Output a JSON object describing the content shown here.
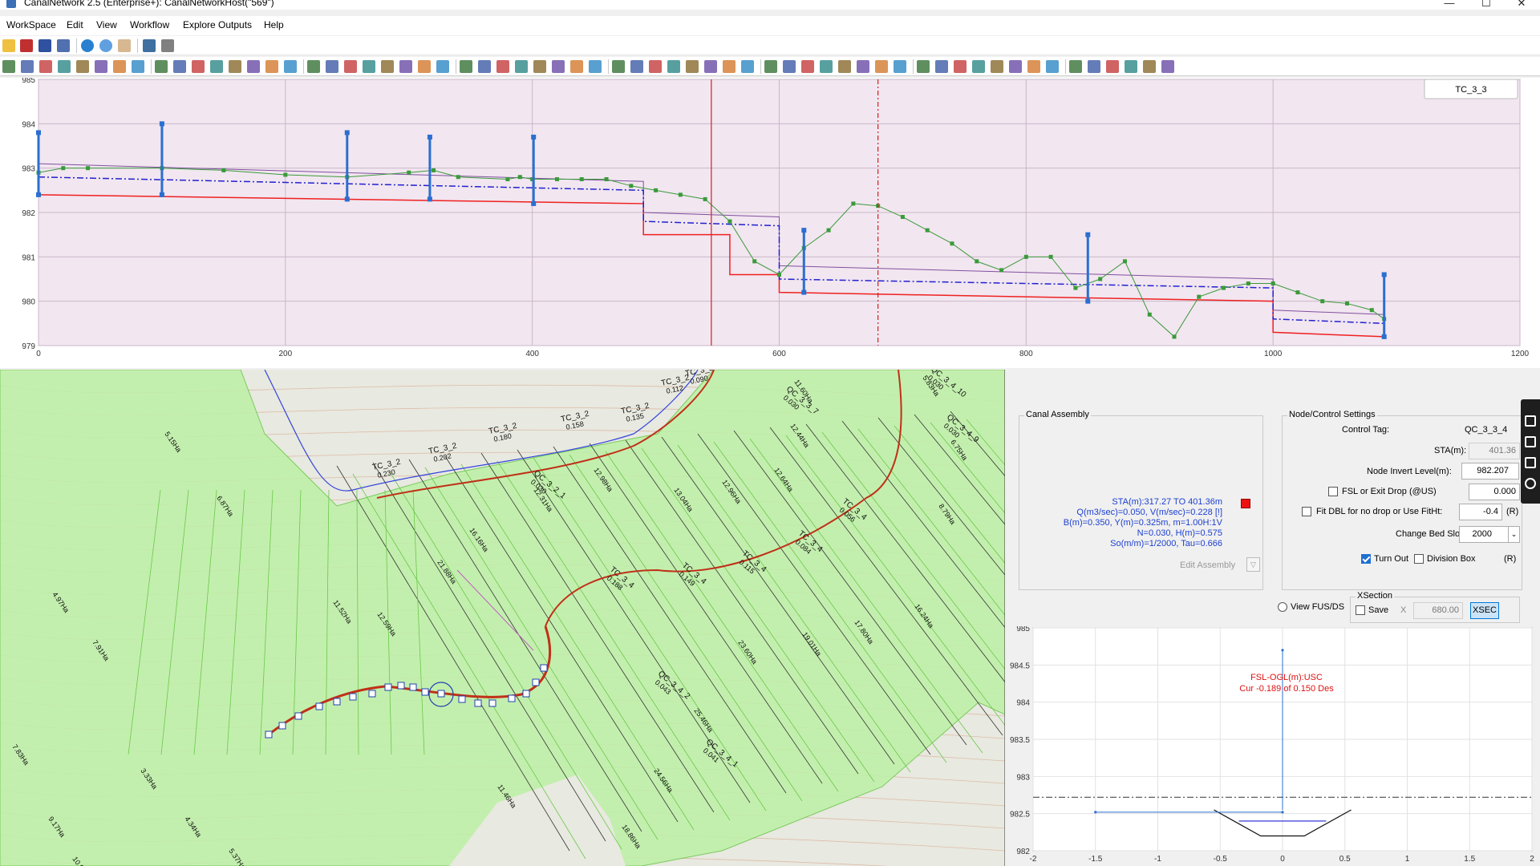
{
  "window": {
    "title": "CanalNetwork 2.5  (Enterprise+): CanalNetworkHost(\"569\")",
    "controls": [
      "—",
      "☐",
      "✕"
    ]
  },
  "menu": [
    "WorkSpace",
    "Edit",
    "View",
    "Workflow",
    "Explore Outputs",
    "Help"
  ],
  "toolbar1": {
    "icons": [
      "open-folder",
      "save-red",
      "save",
      "list",
      "zoom-in",
      "zoom-extents",
      "pan-hand",
      "select-window",
      "pointer"
    ]
  },
  "toolbar2": {
    "icons": [
      "tool",
      "tool",
      "tool",
      "tool",
      "tool",
      "tool",
      "tool",
      "tool",
      "tool",
      "tool",
      "tool",
      "tool",
      "tool",
      "tool",
      "tool",
      "tool",
      "tool",
      "tool",
      "tool",
      "tool",
      "tool",
      "tool",
      "tool",
      "tool",
      "tool",
      "tool",
      "tool",
      "tool",
      "tool",
      "tool",
      "tool",
      "tool",
      "tool",
      "tool",
      "tool",
      "tool",
      "tool",
      "tool",
      "tool",
      "tool",
      "tool",
      "tool",
      "tool",
      "tool",
      "tool",
      "tool",
      "tool",
      "tool",
      "tool",
      "tool",
      "tool",
      "tool",
      "tool",
      "tool",
      "tool",
      "tool",
      "tool",
      "tool",
      "tool",
      "tool",
      "tool",
      "tool"
    ]
  },
  "profile": {
    "canal_tag": "TC_3_3",
    "colors": {
      "bg": "#f2e6f0",
      "ground": "#3a9a3a",
      "bed": "#ef2020",
      "bank": "#8050a0",
      "fsl": "#2020d0",
      "structure": "#2a6fd0",
      "cursor": "#d02020"
    },
    "chart_data": {
      "type": "line",
      "xlim": [
        0,
        1200
      ],
      "ylim": [
        979,
        985
      ],
      "xticks": [
        "0",
        "200",
        "400",
        "600",
        "800",
        "1000",
        "1200"
      ],
      "yticks": [
        "979",
        "980",
        "981",
        "982",
        "983",
        "984",
        "985"
      ],
      "ground": {
        "x": [
          0,
          20,
          40,
          100,
          150,
          200,
          250,
          300,
          320,
          340,
          380,
          390,
          400,
          420,
          440,
          460,
          480,
          500,
          520,
          540,
          560,
          580,
          600,
          620,
          640,
          660,
          680,
          700,
          720,
          740,
          760,
          780,
          800,
          820,
          840,
          860,
          880,
          900,
          920,
          940,
          960,
          980,
          1000,
          1020,
          1040,
          1060,
          1080,
          1090
        ],
        "y": [
          982.9,
          983,
          983,
          983,
          982.95,
          982.85,
          982.8,
          982.9,
          982.95,
          982.8,
          982.75,
          982.8,
          982.75,
          982.75,
          982.75,
          982.75,
          982.6,
          982.5,
          982.4,
          982.3,
          981.8,
          980.9,
          980.6,
          981.2,
          981.6,
          982.2,
          982.15,
          981.9,
          981.6,
          981.3,
          980.9,
          980.7,
          981,
          981.0,
          980.3,
          980.5,
          980.9,
          979.7,
          979.2,
          980.1,
          980.3,
          980.4,
          980.4,
          980.2,
          980.0,
          979.95,
          979.8,
          979.6
        ]
      },
      "bed": {
        "x": [
          0,
          490,
          490,
          560,
          560,
          600,
          600,
          1000,
          1000,
          1090
        ],
        "y": [
          982.4,
          982.2,
          981.5,
          981.5,
          980.6,
          980.6,
          980.2,
          980.0,
          979.3,
          979.2
        ]
      },
      "fsl": {
        "x": [
          0,
          490,
          490,
          600,
          600,
          1000,
          1000,
          1090
        ],
        "y": [
          982.8,
          982.5,
          981.8,
          981.7,
          980.5,
          980.3,
          979.6,
          979.5
        ]
      },
      "bank": {
        "x": [
          0,
          490,
          490,
          600,
          600,
          1000,
          1000,
          1090
        ],
        "y": [
          983.1,
          982.7,
          982.0,
          981.9,
          980.8,
          980.5,
          979.8,
          979.7
        ]
      },
      "structures": [
        {
          "x": 0,
          "top": 983.8,
          "bottom": 982.4
        },
        {
          "x": 100,
          "top": 984.0,
          "bottom": 982.4
        },
        {
          "x": 250,
          "top": 983.8,
          "bottom": 982.3
        },
        {
          "x": 317,
          "top": 983.7,
          "bottom": 982.3
        },
        {
          "x": 401,
          "top": 983.7,
          "bottom": 982.2
        },
        {
          "x": 620,
          "top": 981.6,
          "bottom": 980.2
        },
        {
          "x": 850,
          "top": 981.5,
          "bottom": 980.0
        },
        {
          "x": 1090,
          "top": 980.6,
          "bottom": 979.2
        }
      ],
      "cursors": [
        {
          "x": 545,
          "style": "solid"
        },
        {
          "x": 680,
          "style": "dashed"
        }
      ]
    }
  },
  "map": {
    "labels": [
      {
        "t": "TC_3_2",
        "s": "0.230"
      },
      {
        "t": "TC_3_2",
        "s": "0.202"
      },
      {
        "t": "TC_3_2",
        "s": "0.180"
      },
      {
        "t": "TC_3_2",
        "s": "0.158"
      },
      {
        "t": "TC_3_2",
        "s": "0.135"
      },
      {
        "t": "TC_3_2",
        "s": "0.112"
      },
      {
        "t": "TC_3_3",
        "s": "0.090"
      },
      {
        "t": "TC_3_4",
        "s": "0.188"
      },
      {
        "t": "TC_3_4",
        "s": "0.149"
      },
      {
        "t": "TC_3_4",
        "s": "0.115"
      },
      {
        "t": "TC_3_4",
        "s": "0.084"
      },
      {
        "t": "TC_3_4",
        "s": "0.056"
      },
      {
        "t": "QC_3_4_10",
        "s": "0.030"
      },
      {
        "t": "QC_3_4_9",
        "s": "0.030"
      },
      {
        "t": "QC_3_3_7",
        "s": "0.030"
      },
      {
        "t": "QC_3_2_1",
        "s": "0.030"
      },
      {
        "t": "QC_3_4_1",
        "s": "0.041"
      },
      {
        "t": "QC_3_4_2",
        "s": "0.043"
      }
    ],
    "areas": [
      "5.83Ha",
      "11.60Ha",
      "12.44Ha",
      "6.75Ha",
      "8.79Ha",
      "12.64Ha",
      "12.96Ha",
      "13.04Ha",
      "12.98Ha",
      "12.31Ha",
      "16.16Ha",
      "21.88Ha",
      "11.52Ha",
      "12.59Ha",
      "23.60Ha",
      "19.01Ha",
      "17.80Ha",
      "16.24Ha",
      "25.46Ha",
      "24.56Ha",
      "18.86Ha",
      "11.46Ha",
      "9.17Ha",
      "10.95Ha",
      "5.37Ha",
      "4.34Ha",
      "3.33Ha",
      "7.83Ha",
      "7.91Ha",
      "4.97Ha",
      "6.87Ha",
      "5.15Ha"
    ],
    "colors": {
      "bg": "#e8e9e0",
      "command": "#bff0a8",
      "dark_line": "#333333",
      "green_line": "#6ac84a",
      "canal": "#c03018",
      "contour": "#d8a890",
      "stream": "#3344dd"
    }
  },
  "canal_assembly": {
    "title": "Canal Assembly",
    "lines": [
      "STA(m):317.27 TO 401.36m",
      "Q(m3/sec)=0.050, V(m/sec)=0.228 [!]",
      "B(m)=0.350, Y(m)=0.325m, m=1.00H:1V",
      "N=0.030, H(m)=0.575",
      "So(m/m)=1/2000, Tau=0.666"
    ],
    "edit_label": "Edit Assembly",
    "flag_color": "#ee1111"
  },
  "node_settings": {
    "title": "Node/Control Settings",
    "control_tag_label": "Control Tag:",
    "control_tag": "QC_3_3_4",
    "sta_label": "STA(m):",
    "sta": "401.36",
    "invert_label": "Node Invert Level(m):",
    "invert": "982.207",
    "fsl_label": "FSL or Exit Drop (@US)",
    "fsl_value": "0.000",
    "fit_label": "Fit DBL for no drop or Use FitHt:",
    "fit_value": "-0.4",
    "r_label": "(R)",
    "bedslope_label": "Change Bed Slope",
    "bedslope": "2000",
    "turnout_label": "Turn Out",
    "turnout_checked": true,
    "division_label": "Division Box",
    "division_r": "(R)"
  },
  "view_fus_label": "View FUS/DS",
  "xsection": {
    "title": "XSection",
    "save_label": "Save",
    "x_label": "X",
    "x_value": "680.00",
    "btn": "XSEC"
  },
  "xsec_chart": {
    "annot1": "FSL-OGL(m):USC",
    "annot2": "Cur -0.189 of 0.150 Des",
    "chart_data": {
      "type": "line",
      "xlim": [
        -2,
        2
      ],
      "ylim": [
        982,
        985
      ],
      "xticks": [
        "-2",
        "-1.5",
        "-1",
        "-0.5",
        "0",
        "0.5",
        "1",
        "1.5",
        "2"
      ],
      "yticks": [
        "982",
        "982.5",
        "983",
        "983.5",
        "984",
        "984.5",
        "985"
      ],
      "section": {
        "x": [
          -0.55,
          -0.175,
          0.175,
          0.55
        ],
        "y": [
          982.55,
          982.2,
          982.2,
          982.55
        ]
      },
      "water": {
        "x": [
          -0.35,
          0.35
        ],
        "y": [
          982.4,
          982.4
        ]
      },
      "ground": {
        "x": [
          -1.5,
          0
        ],
        "y": [
          982.52,
          982.52
        ]
      },
      "fsl_line": 982.72,
      "center_top": 984.7
    }
  }
}
